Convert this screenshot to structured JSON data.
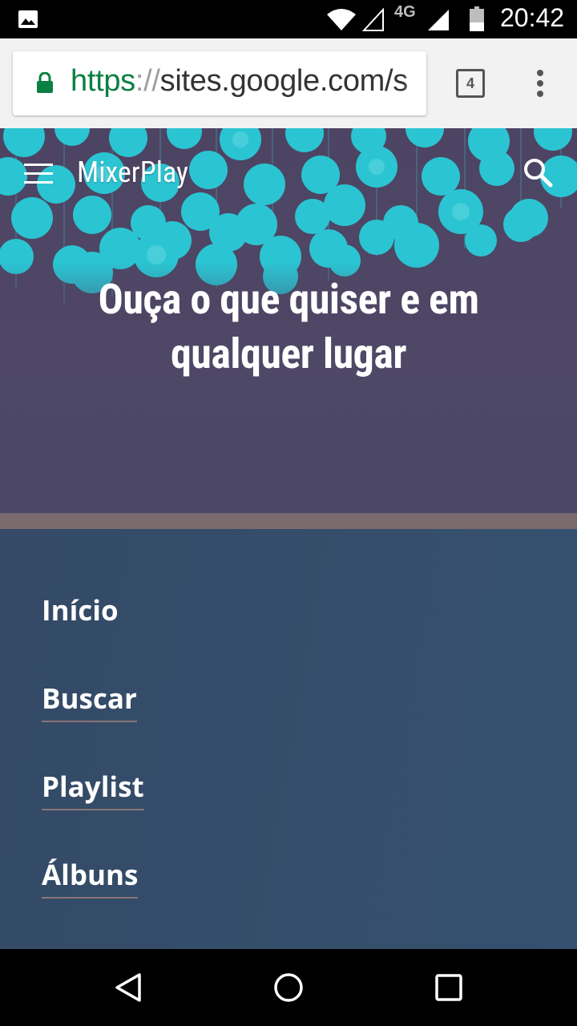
{
  "status_bar": {
    "network_type": "4G",
    "time": "20:42"
  },
  "browser": {
    "url_scheme": "https",
    "url_separator": "://",
    "url_host": "sites.google.com/s",
    "tab_count": "4"
  },
  "site": {
    "title": "MixerPlay",
    "hero_heading": "Ouça o que quiser e em qualquer lugar"
  },
  "nav": {
    "items": [
      {
        "label": "Início"
      },
      {
        "label": "Buscar"
      },
      {
        "label": "Playlist"
      },
      {
        "label": "Álbuns"
      }
    ]
  },
  "colors": {
    "hero_bg": "#4d4463",
    "dots": "#2bc4d2",
    "divider": "#7a6a6e",
    "nav_bg": "#344a66",
    "secure_green": "#0b8043"
  },
  "icons": {
    "status": [
      "gallery-icon",
      "wifi-icon",
      "signal-icon",
      "battery-icon"
    ],
    "browser": [
      "lock-icon",
      "tabs-icon",
      "overflow-menu-icon"
    ],
    "site": [
      "hamburger-menu-icon",
      "search-icon"
    ],
    "system": [
      "back-icon",
      "home-icon",
      "recents-icon"
    ]
  }
}
